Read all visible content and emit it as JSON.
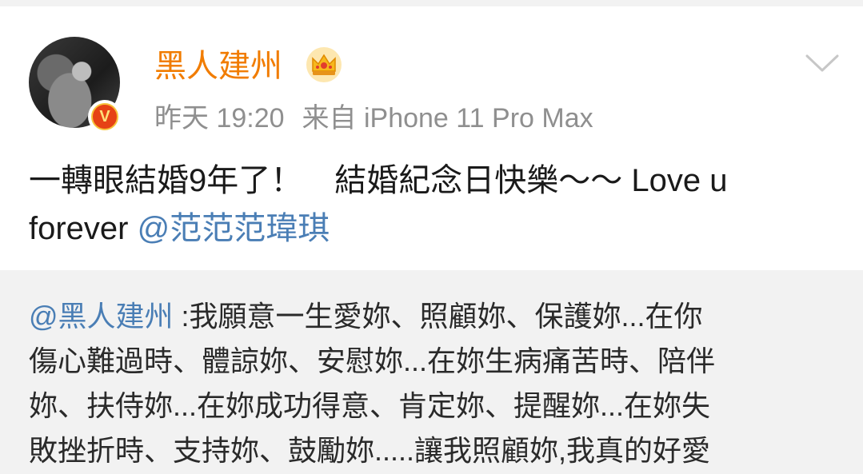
{
  "post": {
    "username": "黑人建州",
    "time": "昨天 19:20",
    "source": "来自 iPhone 11 Pro Max",
    "verified_badge": "V",
    "content_line1": "一轉眼結婚9年了！　結婚紀念日快樂～～ Love u",
    "content_line2_text": "forever ",
    "content_mention": "@范范范瑋琪"
  },
  "repost": {
    "mention": "@黑人建州",
    "line1_text": " :我願意一生愛妳、照顧妳、保護妳...在你",
    "line2": "傷心難過時、體諒妳、安慰妳...在妳生病痛苦時、陪伴",
    "line3": "妳、扶侍妳...在妳成功得意、肯定妳、提醒妳...在妳失",
    "line4": "敗挫折時、支持妳、鼓勵妳.....讓我照顧妳,我真的好愛"
  },
  "icons": {
    "crown": "crown-icon",
    "more": "chevron-down-icon",
    "verified": "verified-badge-icon"
  },
  "colors": {
    "username": "#f17c00",
    "mention": "#4a7eb5",
    "meta": "#8f8f8f",
    "repost_bg": "#f2f2f2"
  }
}
